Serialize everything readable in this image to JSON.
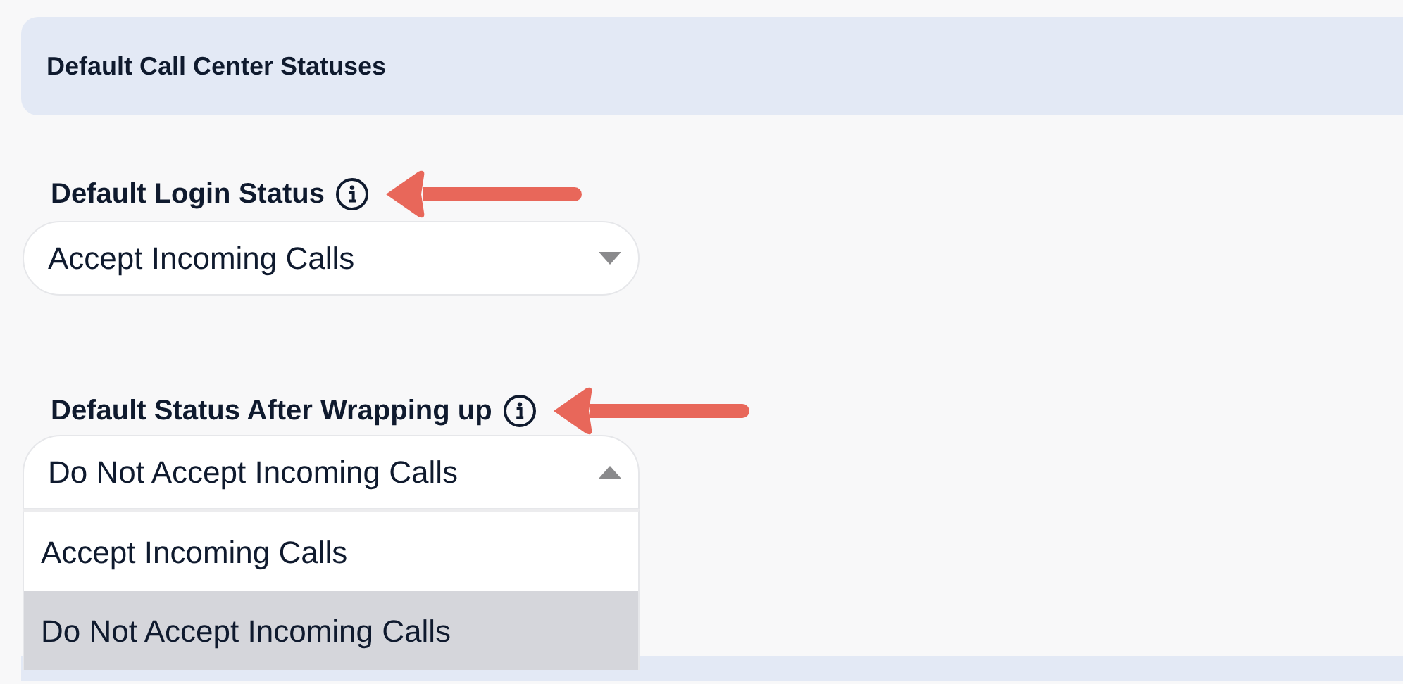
{
  "section": {
    "title": "Default Call Center Statuses"
  },
  "fields": [
    {
      "label": "Default Login Status",
      "value": "Accept Incoming Calls",
      "expanded": false,
      "annotation_arrow": true
    },
    {
      "label": "Default Status After Wrapping up",
      "value": "Do Not Accept Incoming Calls",
      "expanded": true,
      "annotation_arrow": true,
      "options": [
        {
          "label": "Accept Incoming Calls",
          "selected": false
        },
        {
          "label": "Do Not Accept Incoming Calls",
          "selected": true
        }
      ]
    }
  ]
}
